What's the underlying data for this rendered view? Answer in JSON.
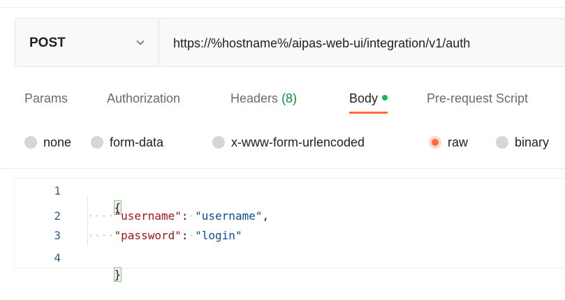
{
  "request": {
    "method": "POST",
    "url": "https://%hostname%/aipas-web-ui/integration/v1/auth"
  },
  "tabs": {
    "params": "Params",
    "authorization": "Authorization",
    "headers_label": "Headers",
    "headers_count": "(8)",
    "body": "Body",
    "prerequest": "Pre-request Script"
  },
  "body_types": {
    "none": "none",
    "form_data": "form-data",
    "urlencoded": "x-www-form-urlencoded",
    "raw": "raw",
    "binary": "binary",
    "selected": "raw"
  },
  "editor": {
    "line_numbers": [
      "1",
      "2",
      "3",
      "4"
    ],
    "open_brace": "{",
    "close_brace": "}",
    "indent": "····",
    "space_dot": "·",
    "username_key": "\"username\"",
    "username_value": "\"username\"",
    "password_key": "\"password\"",
    "password_value": "\"login\"",
    "colon": ":",
    "comma": ","
  },
  "colors": {
    "accent": "#ff6c37",
    "active_dot": "#0cbb52",
    "headers_count": "#0f8b3d",
    "json_key": "#a31515",
    "json_string": "#0a4a9f"
  }
}
